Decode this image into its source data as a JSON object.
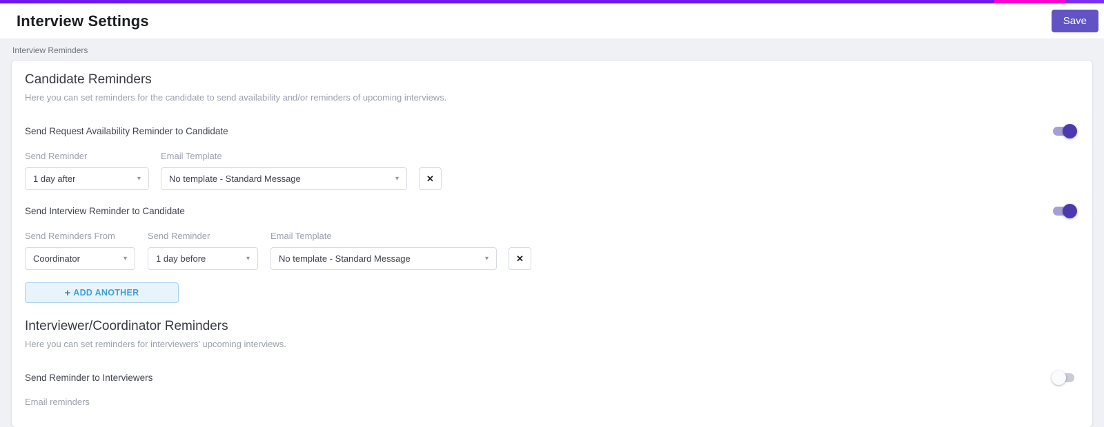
{
  "colors": {
    "accent_purple": "#6e17ee",
    "accent_pink": "#fb00cf",
    "save_button": "#6253c5",
    "toggle_on_track": "#a79ed6",
    "toggle_on_knob": "#4a3aae",
    "toggle_off_track": "#c9ccd6",
    "toggle_off_knob": "#fafbfc",
    "add_button_bg": "#e8f4fb",
    "add_button_border": "#a5d0e9",
    "add_button_text": "#3ba1d8"
  },
  "icons": {
    "chevron_down": "▾",
    "clear": "✕",
    "plus": "+"
  },
  "header": {
    "title": "Interview Settings",
    "save_label": "Save"
  },
  "subnav": {
    "label": "Interview Reminders"
  },
  "candidate": {
    "title": "Candidate Reminders",
    "description": "Here you can set reminders for the candidate to send availability and/or reminders of upcoming interviews.",
    "availability": {
      "label": "Send Request Availability Reminder to Candidate",
      "toggle": "on",
      "send_reminder": {
        "label": "Send Reminder",
        "value": "1 day after"
      },
      "email_template": {
        "label": "Email Template",
        "value": "No template - Standard Message"
      }
    },
    "interview": {
      "label": "Send Interview Reminder to Candidate",
      "toggle": "on",
      "send_from": {
        "label": "Send Reminders From",
        "value": "Coordinator"
      },
      "send_reminder": {
        "label": "Send Reminder",
        "value": "1 day before"
      },
      "email_template": {
        "label": "Email Template",
        "value": "No template - Standard Message"
      }
    },
    "add_another_label": "ADD ANOTHER"
  },
  "interviewer": {
    "title": "Interviewer/Coordinator Reminders",
    "description": "Here you can set reminders for interviewers' upcoming interviews.",
    "send_reminder_label": "Send Reminder to Interviewers",
    "toggle": "off",
    "email_reminders_label": "Email reminders"
  }
}
